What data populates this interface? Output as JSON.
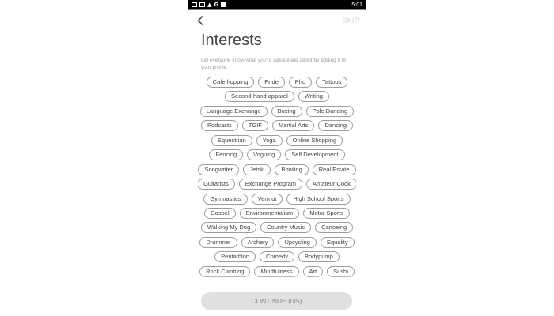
{
  "status_bar": {
    "time": "5:01",
    "icons": [
      "gallery-icon",
      "gallery-icon",
      "warning-icon",
      "google-icon",
      "save-icon"
    ]
  },
  "header": {
    "back_icon": "chevron-left-icon",
    "skip_label": "SKIP"
  },
  "title": "Interests",
  "subtitle": "Let everyone know what you're passionate about by adding it to your profile.",
  "interest_rows": [
    [
      "Cafe hopping",
      "Pride",
      "Pho",
      "Tattoos"
    ],
    [
      "Second-hand apparel",
      "Writing"
    ],
    [
      "Language Exchange",
      "Boxing",
      "Pole Dancing"
    ],
    [
      "Podcasts",
      "TGIF",
      "Martial Arts",
      "Dancing"
    ],
    [
      "Equestrian",
      "Yoga",
      "Online Shopping"
    ],
    [
      "Fencing",
      "Voguing",
      "Self Development"
    ],
    [
      "Songwriter",
      "Jetski",
      "Bowling",
      "Real Estate"
    ],
    [
      "Guitarists",
      "Exchange Program",
      "Amateur Cook"
    ],
    [
      "Gymnastics",
      "Vermut",
      "High School Sports"
    ],
    [
      "Gospel",
      "Environmentalism",
      "Motor Sports"
    ],
    [
      "Walking My Dog",
      "Country Music",
      "Canoeing"
    ],
    [
      "Drummer",
      "Archery",
      "Upcycling",
      "Equality"
    ],
    [
      "Pentathlon",
      "Comedy",
      "Bodypump"
    ],
    [
      "Rock Climbing",
      "Mindfulness",
      "Art",
      "Sushi"
    ]
  ],
  "continue_label": "CONTINUE (0/5)",
  "colors": {
    "accent": "#ff4458",
    "chip_border": "#9e9e9e",
    "text": "#424242",
    "button_bg": "#e0e0e0"
  }
}
